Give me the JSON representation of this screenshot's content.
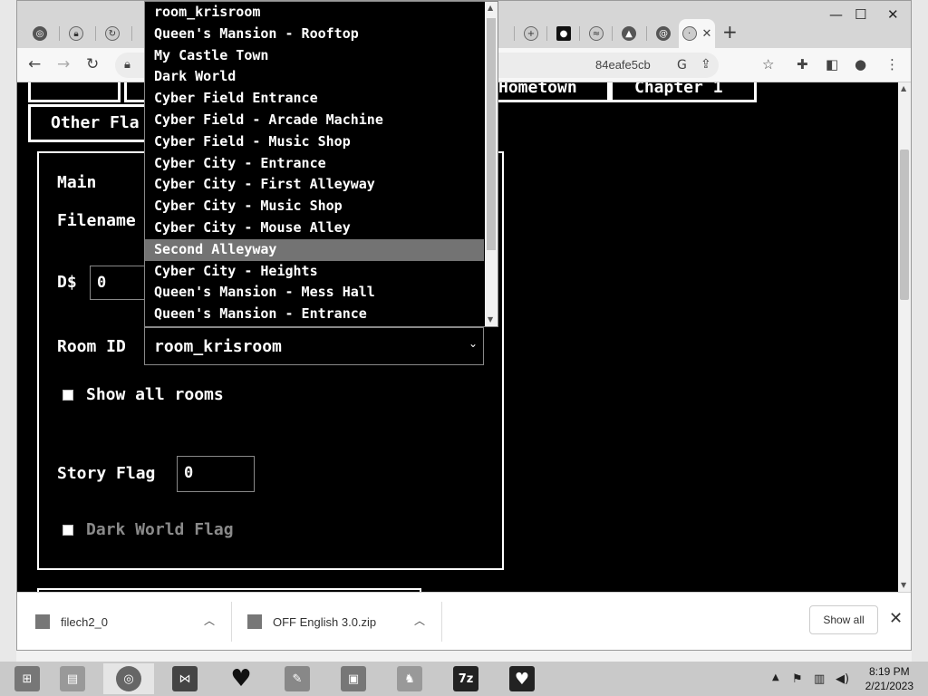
{
  "browser": {
    "url_fragment": "84eafe5cb",
    "tabs_new_label": "+",
    "window_controls": {
      "minimize": "—",
      "maximize": "☐",
      "close": "✕"
    }
  },
  "page": {
    "top_buttons": [
      "Hometown",
      "Chapter 1"
    ],
    "other_flags_label": "Other Fla",
    "main_title": "Main",
    "filename_label": "Filename",
    "money_label": "D$",
    "money_value": "0",
    "room_id_label": "Room ID",
    "room_id_value": "room_krisroom",
    "show_all_rooms_label": "Show all rooms",
    "story_flag_label": "Story Flag",
    "story_flag_value": "0",
    "dark_world_flag_label": "Dark World Flag"
  },
  "dropdown": {
    "items": [
      "room_krisroom",
      "Queen's Mansion - Rooftop",
      "My Castle Town",
      "Dark World",
      "Cyber Field Entrance",
      "Cyber Field - Arcade Machine",
      "Cyber Field - Music Shop",
      "Cyber City - Entrance",
      "Cyber City - First Alleyway",
      "Cyber City - Music Shop",
      "Cyber City - Mouse Alley",
      "Second Alleyway",
      "Cyber City - Heights",
      "Queen's Mansion - Mess Hall",
      "Queen's Mansion - Entrance"
    ],
    "highlighted": "Second Alleyway"
  },
  "downloads": {
    "items": [
      "filech2_0",
      "OFF English 3.0.zip"
    ],
    "show_all_label": "Show all"
  },
  "taskbar": {
    "time": "8:19 PM",
    "date": "2/21/2023"
  }
}
